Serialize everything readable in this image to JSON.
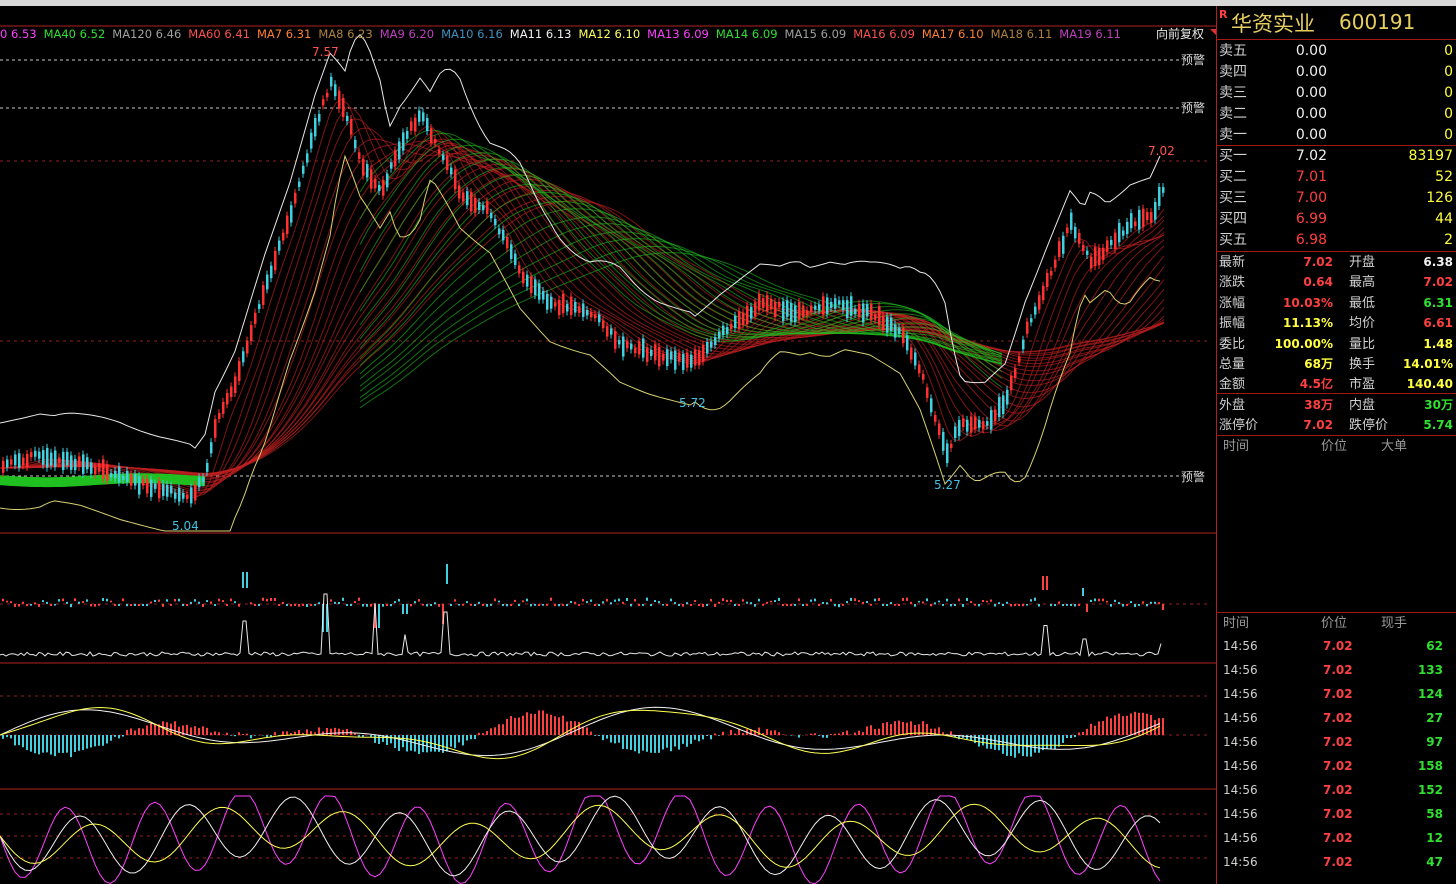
{
  "stock": {
    "name": "华资实业",
    "code": "600191",
    "r_mark": "R"
  },
  "ma_legend": [
    {
      "label": "0",
      "value": "6.53",
      "color": "#ff40ff"
    },
    {
      "label": "MA40",
      "value": "6.52",
      "color": "#30e030"
    },
    {
      "label": "MA120",
      "value": "6.46",
      "color": "#a0a0a0"
    },
    {
      "label": "MA60",
      "value": "6.41",
      "color": "#ff5050"
    },
    {
      "label": "MA7",
      "value": "6.31",
      "color": "#ff8030"
    },
    {
      "label": "MA8",
      "value": "6.23",
      "color": "#b08040"
    },
    {
      "label": "MA9",
      "value": "6.20",
      "color": "#c040c0"
    },
    {
      "label": "MA10",
      "value": "6.16",
      "color": "#4090c0"
    },
    {
      "label": "MA11",
      "value": "6.13",
      "color": "#f0f0f0"
    },
    {
      "label": "MA12",
      "value": "6.10",
      "color": "#ffff60"
    },
    {
      "label": "MA13",
      "value": "6.09",
      "color": "#ff40ff"
    },
    {
      "label": "MA14",
      "value": "6.09",
      "color": "#30e030"
    },
    {
      "label": "MA15",
      "value": "6.09",
      "color": "#a0a0a0"
    },
    {
      "label": "MA16",
      "value": "6.09",
      "color": "#ff5050"
    },
    {
      "label": "MA17",
      "value": "6.10",
      "color": "#ff8030"
    },
    {
      "label": "MA18",
      "value": "6.11",
      "color": "#b08040"
    },
    {
      "label": "MA19",
      "value": "6.11",
      "color": "#c040c0"
    }
  ],
  "restore_label": "向前复权",
  "chart_labels": {
    "high": "7.57",
    "high2": "7.02",
    "low1": "5.04",
    "low2": "5.72",
    "low3": "5.27",
    "alert": "预警"
  },
  "order_book": [
    {
      "label": "卖五",
      "price": "0.00",
      "vol": "0",
      "pcolor": "#f0f0f0"
    },
    {
      "label": "卖四",
      "price": "0.00",
      "vol": "0",
      "pcolor": "#f0f0f0"
    },
    {
      "label": "卖三",
      "price": "0.00",
      "vol": "0",
      "pcolor": "#f0f0f0"
    },
    {
      "label": "卖二",
      "price": "0.00",
      "vol": "0",
      "pcolor": "#f0f0f0"
    },
    {
      "label": "卖一",
      "price": "0.00",
      "vol": "0",
      "pcolor": "#f0f0f0"
    },
    {
      "label": "买一",
      "price": "7.02",
      "vol": "83197",
      "pcolor": "#f0f0f0"
    },
    {
      "label": "买二",
      "price": "7.01",
      "vol": "52",
      "pcolor": "#ff4040"
    },
    {
      "label": "买三",
      "price": "7.00",
      "vol": "126",
      "pcolor": "#ff4040"
    },
    {
      "label": "买四",
      "price": "6.99",
      "vol": "44",
      "pcolor": "#ff4040"
    },
    {
      "label": "买五",
      "price": "6.98",
      "vol": "2",
      "pcolor": "#ff4040"
    }
  ],
  "stats": [
    {
      "l1": "最新",
      "v1": "7.02",
      "c1": "#ff4040",
      "l2": "开盘",
      "v2": "6.38",
      "c2": "#f0f0f0"
    },
    {
      "l1": "涨跌",
      "v1": "0.64",
      "c1": "#ff4040",
      "l2": "最高",
      "v2": "7.02",
      "c2": "#ff4040"
    },
    {
      "l1": "涨幅",
      "v1": "10.03%",
      "c1": "#ff4040",
      "l2": "最低",
      "v2": "6.31",
      "c2": "#30e030"
    },
    {
      "l1": "振幅",
      "v1": "11.13%",
      "c1": "#ffff40",
      "l2": "均价",
      "v2": "6.61",
      "c2": "#ff4040"
    },
    {
      "l1": "委比",
      "v1": "100.00%",
      "c1": "#ffff40",
      "l2": "量比",
      "v2": "1.48",
      "c2": "#ffff40"
    },
    {
      "l1": "总量",
      "v1": "68万",
      "c1": "#ffff40",
      "l2": "换手",
      "v2": "14.01%",
      "c2": "#ffff40"
    },
    {
      "l1": "金额",
      "v1": "4.5亿",
      "c1": "#ff4040",
      "l2": "市盈",
      "v2": "140.40",
      "c2": "#ffff40"
    },
    {
      "l1": "外盘",
      "v1": "38万",
      "c1": "#ff4040",
      "l2": "内盘",
      "v2": "30万",
      "c2": "#30e030"
    },
    {
      "l1": "涨停价",
      "v1": "7.02",
      "c1": "#ff4040",
      "l2": "跌停价",
      "v2": "5.74",
      "c2": "#30e030"
    }
  ],
  "big_order_header": {
    "time": "时间",
    "price": "价位",
    "big": "大单"
  },
  "tick_header": {
    "time": "时间",
    "price": "价位",
    "vol": "现手"
  },
  "ticks": [
    {
      "time": "14:56",
      "price": "7.02",
      "vol": "62"
    },
    {
      "time": "14:56",
      "price": "7.02",
      "vol": "133"
    },
    {
      "time": "14:56",
      "price": "7.02",
      "vol": "124"
    },
    {
      "time": "14:56",
      "price": "7.02",
      "vol": "27"
    },
    {
      "time": "14:56",
      "price": "7.02",
      "vol": "97"
    },
    {
      "time": "14:56",
      "price": "7.02",
      "vol": "158"
    },
    {
      "time": "14:56",
      "price": "7.02",
      "vol": "152"
    },
    {
      "time": "14:56",
      "price": "7.02",
      "vol": "58"
    },
    {
      "time": "14:56",
      "price": "7.02",
      "vol": "12"
    },
    {
      "time": "14:56",
      "price": "7.02",
      "vol": "47"
    }
  ]
}
